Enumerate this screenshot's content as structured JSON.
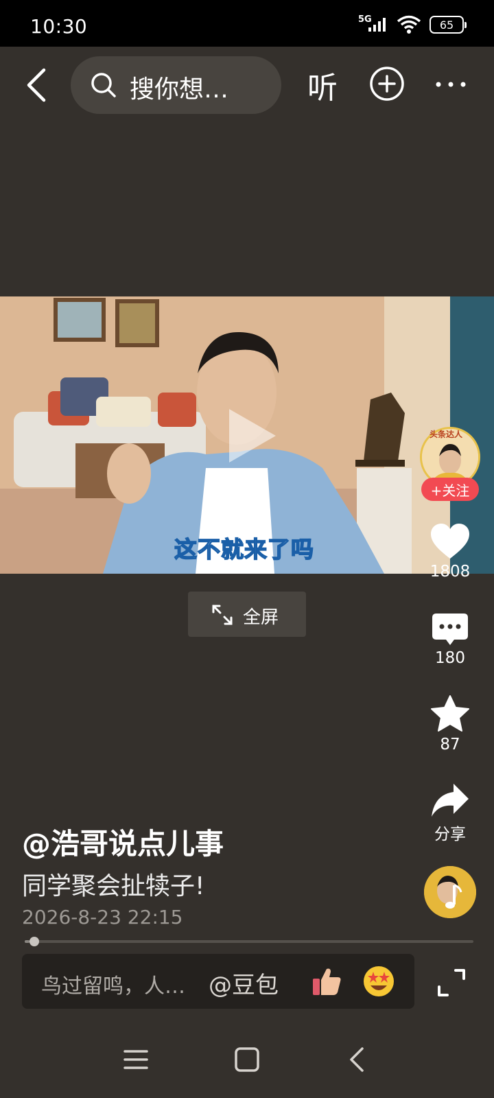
{
  "status_bar": {
    "time": "10:30",
    "network": "5G",
    "battery": "65",
    "icons": [
      "signal-icon",
      "wifi-icon",
      "battery-icon"
    ]
  },
  "top_bar": {
    "search_placeholder": "搜你想…",
    "listen_label": "听",
    "icons": [
      "back-arrow-icon",
      "search-icon",
      "plus-circle-icon",
      "more-dots-icon"
    ]
  },
  "video": {
    "subtitle": "这不就来了吗",
    "fullscreen_label": "全屏",
    "play_icon": "play-icon"
  },
  "author": {
    "badge": "头条达人",
    "follow_label": "+关注",
    "name": "@浩哥说点儿事"
  },
  "actions": {
    "like_count": "1808",
    "comment_count": "180",
    "favorite_count": "87",
    "share_label": "分享"
  },
  "post": {
    "caption": "同学聚会扯犊子!",
    "date": "2026-8-23 22:15",
    "progress": 0.01
  },
  "comment_bar": {
    "placeholder": "鸟过留鸣，人…",
    "mention": "@豆包",
    "emoji_buttons": [
      "thumbs-up-emoji",
      "star-eyes-emoji"
    ]
  },
  "nav_bar": {
    "icons": [
      "menu-icon",
      "home-icon",
      "back-icon"
    ]
  },
  "colors": {
    "background": "#34302c",
    "follow_red": "#f24a52",
    "search_pill": "#48443f"
  }
}
